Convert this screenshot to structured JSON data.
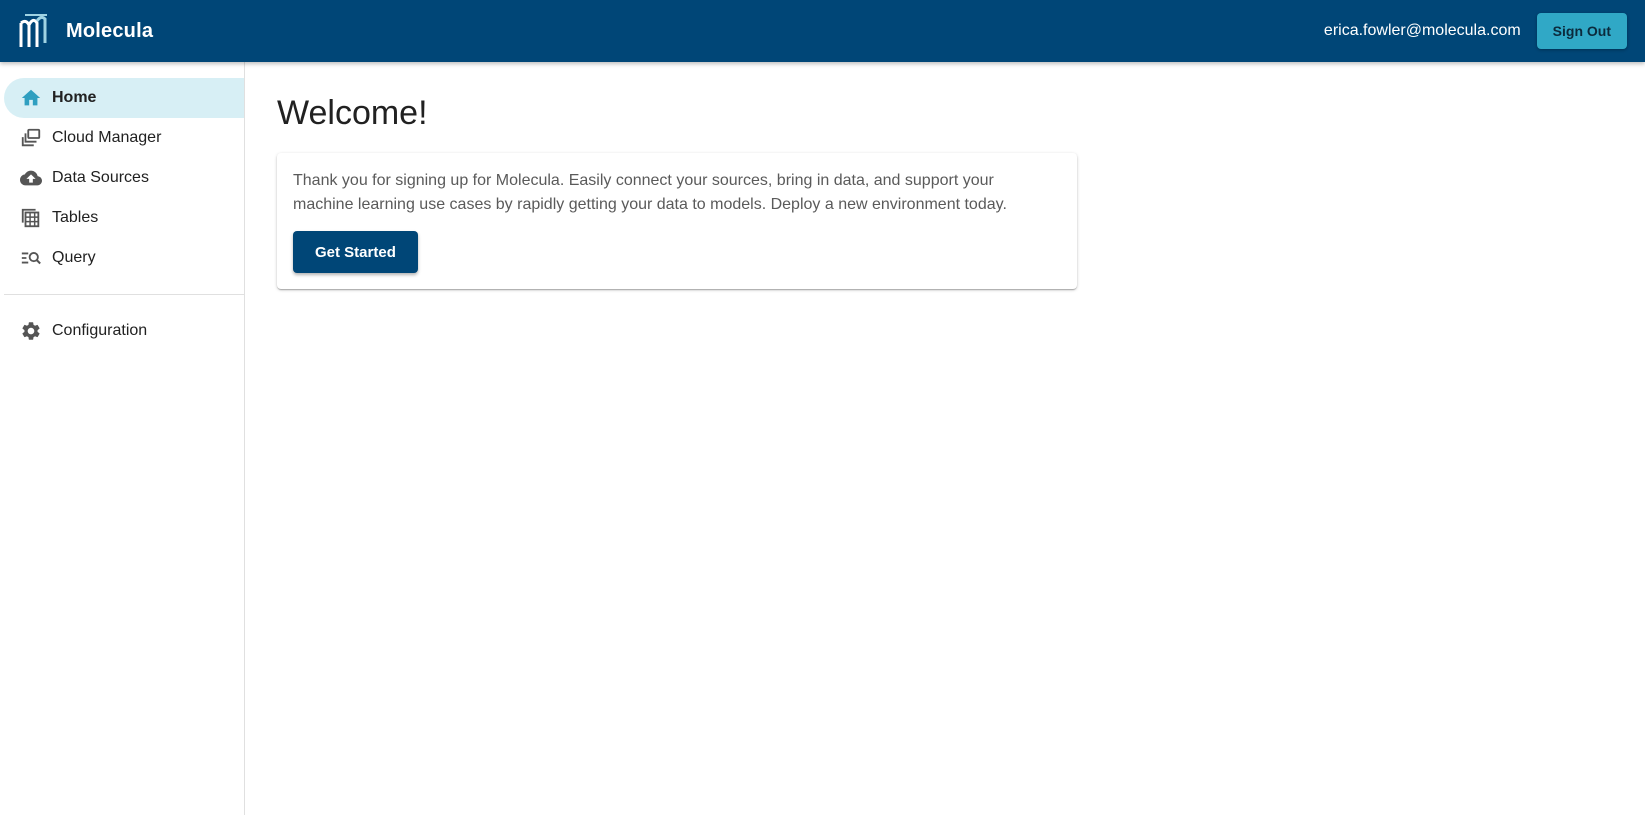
{
  "app": {
    "name": "Molecula",
    "logo_icon": "molecula-logo-icon",
    "brand_color": "#004677",
    "accent_color": "#30a8c6"
  },
  "header": {
    "user_email": "erica.fowler@molecula.com",
    "sign_out_label": "Sign Out"
  },
  "sidebar": {
    "items": [
      {
        "label": "Home",
        "icon": "home-icon",
        "active": true
      },
      {
        "label": "Cloud Manager",
        "icon": "cloud-manager-icon",
        "active": false
      },
      {
        "label": "Data Sources",
        "icon": "cloud-upload-icon",
        "active": false
      },
      {
        "label": "Tables",
        "icon": "table-icon",
        "active": false
      },
      {
        "label": "Query",
        "icon": "query-search-icon",
        "active": false
      }
    ],
    "secondary_items": [
      {
        "label": "Configuration",
        "icon": "gear-icon",
        "active": false
      }
    ]
  },
  "main": {
    "title": "Welcome!",
    "card": {
      "text": "Thank you for signing up for Molecula. Easily connect your sources, bring in data, and support your machine learning use cases by rapidly getting your data to models. Deploy a new environment today.",
      "button_label": "Get Started"
    }
  }
}
